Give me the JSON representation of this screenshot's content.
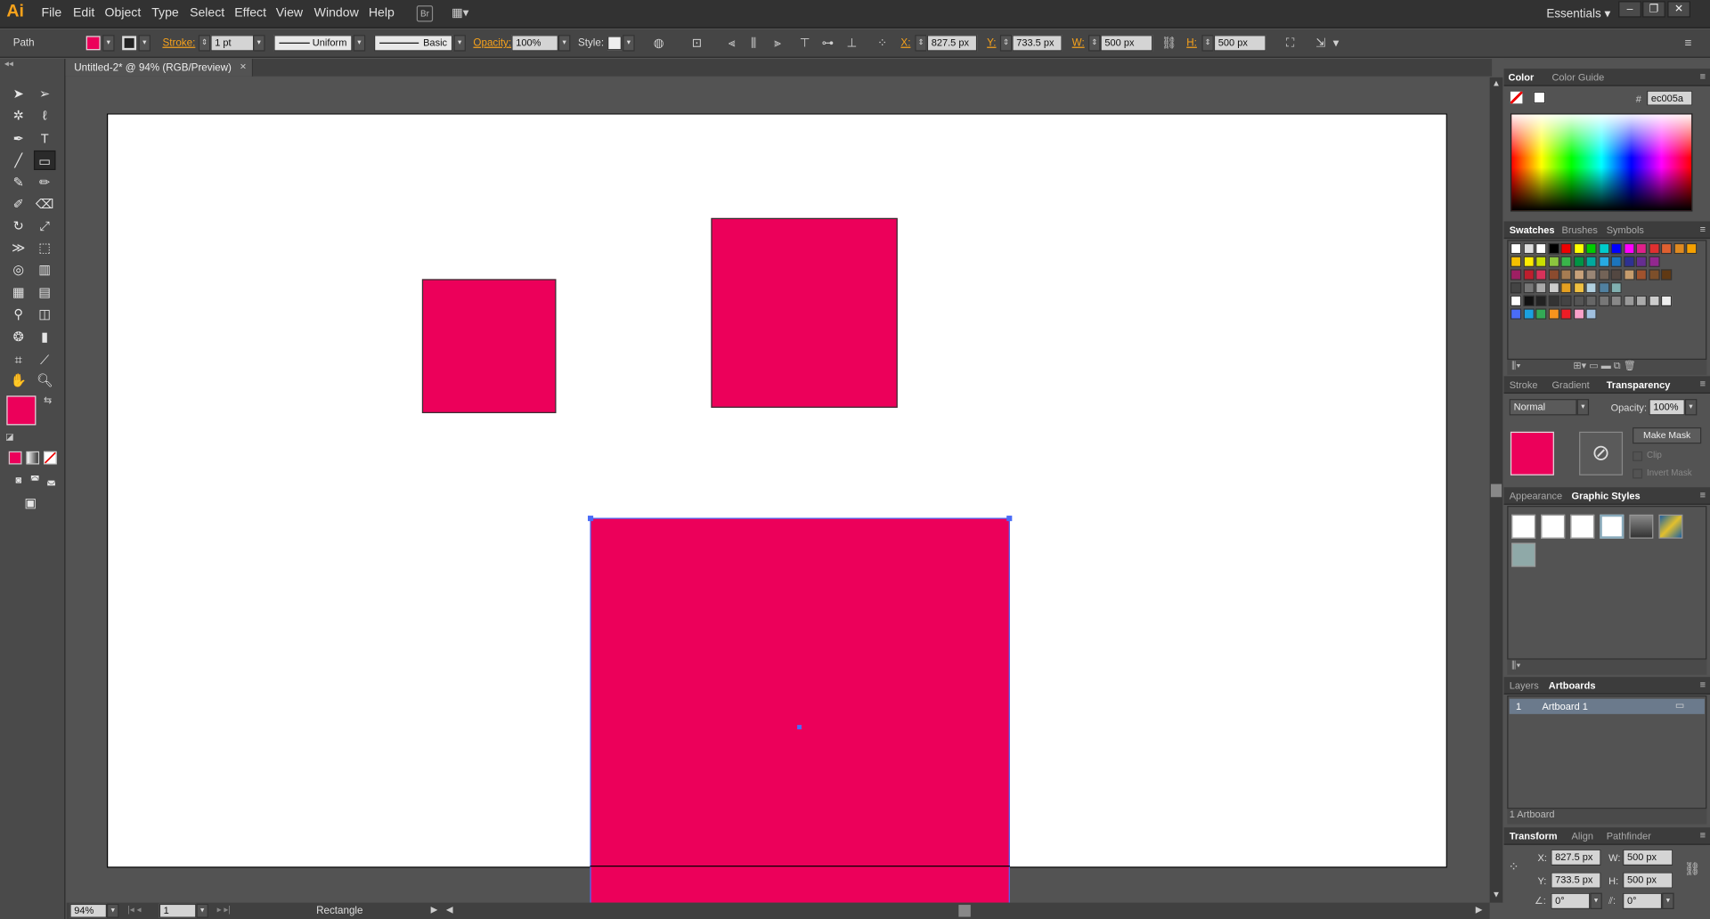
{
  "app": {
    "logo": "Ai",
    "workspace": "Essentials ▾"
  },
  "menu": [
    "File",
    "Edit",
    "Object",
    "Type",
    "Select",
    "Effect",
    "View",
    "Window",
    "Help"
  ],
  "window_controls": [
    "–",
    "❐",
    "✕"
  ],
  "control_bar": {
    "selection_type": "Path",
    "stroke_label": "Stroke:",
    "stroke_weight": "1 pt",
    "profile": "Uniform",
    "brush": "Basic",
    "opacity_label": "Opacity:",
    "opacity": "100%",
    "style_label": "Style:",
    "x_label": "X:",
    "x": "827.5 px",
    "y_label": "Y:",
    "y": "733.5 px",
    "w_label": "W:",
    "w": "500 px",
    "h_label": "H:",
    "h": "500 px"
  },
  "document": {
    "tab_title": "Untitled-2* @ 94% (RGB/Preview)",
    "close": "×"
  },
  "status": {
    "zoom": "94%",
    "artboard_num": "1",
    "tool_name": "Rectangle"
  },
  "colors": {
    "fill": "#ec005a",
    "artboard": "#ffffff",
    "selection": "#4a6cf7"
  },
  "shapes": [
    {
      "name": "small-square",
      "fill": "#ec005a",
      "selected": false
    },
    {
      "name": "medium-square",
      "fill": "#ec005a",
      "selected": false
    },
    {
      "name": "large-square",
      "fill": "#ec005a",
      "selected": true
    }
  ],
  "color_panel": {
    "tabs": [
      "Color",
      "Color Guide"
    ],
    "hex_label": "#",
    "hex": "ec005a"
  },
  "swatches_panel": {
    "tabs": [
      "Swatches",
      "Brushes",
      "Symbols"
    ]
  },
  "transparency_panel": {
    "tabs": [
      "Stroke",
      "Gradient",
      "Transparency"
    ],
    "blend_mode": "Normal",
    "opacity_label": "Opacity:",
    "opacity": "100%",
    "make_mask": "Make Mask",
    "clip": "Clip",
    "invert_mask": "Invert Mask"
  },
  "graphic_styles_panel": {
    "tabs": [
      "Appearance",
      "Graphic Styles"
    ]
  },
  "artboards_panel": {
    "tabs": [
      "Layers",
      "Artboards"
    ],
    "rows": [
      {
        "num": "1",
        "name": "Artboard 1"
      }
    ],
    "footer": "1 Artboard"
  },
  "transform_panel": {
    "tabs": [
      "Transform",
      "Align",
      "Pathfinder"
    ],
    "x_label": "X:",
    "x": "827.5 px",
    "y_label": "Y:",
    "y": "733.5 px",
    "w_label": "W:",
    "w": "500 px",
    "h_label": "H:",
    "h": "500 px",
    "angle": "0°",
    "shear": "0°"
  },
  "tools": [
    "selection-tool",
    "direct-selection-tool",
    "magic-wand-tool",
    "lasso-tool",
    "pen-tool",
    "type-tool",
    "line-tool",
    "rectangle-tool",
    "paintbrush-tool",
    "pencil-tool",
    "blob-brush-tool",
    "eraser-tool",
    "rotate-tool",
    "scale-tool",
    "width-tool",
    "free-transform-tool",
    "shape-builder-tool",
    "perspective-grid-tool",
    "mesh-tool",
    "gradient-tool",
    "eyedropper-tool",
    "blend-tool",
    "symbol-sprayer-tool",
    "column-graph-tool",
    "artboard-tool",
    "slice-tool",
    "hand-tool",
    "zoom-tool"
  ]
}
